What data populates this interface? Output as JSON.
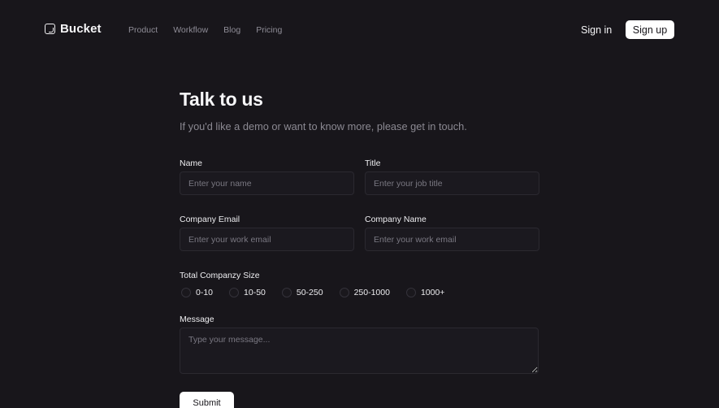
{
  "header": {
    "brand": "Bucket",
    "nav_links": [
      "Product",
      "Workflow",
      "Blog",
      "Pricing"
    ],
    "sign_in": "Sign in",
    "sign_up": "Sign up"
  },
  "form": {
    "title": "Talk to us",
    "subtitle": "If you'd like a demo or want to know more, please get in touch.",
    "name_label": "Name",
    "name_placeholder": "Enter your name",
    "title_label": "Title",
    "title_placeholder": "Enter your job title",
    "email_label": "Company Email",
    "email_placeholder": "Enter your work email",
    "company_label": "Company Name",
    "company_placeholder": "Enter your work email",
    "size_label": "Total Companzy Size",
    "size_options": [
      "0-10",
      "10-50",
      "50-250",
      "250-1000",
      "1000+"
    ],
    "message_label": "Message",
    "message_placeholder": "Type your message...",
    "submit": "Submit"
  },
  "colors": {
    "background": "#18161b",
    "button_bg": "#ffffff",
    "muted_text": "#8b8992"
  }
}
